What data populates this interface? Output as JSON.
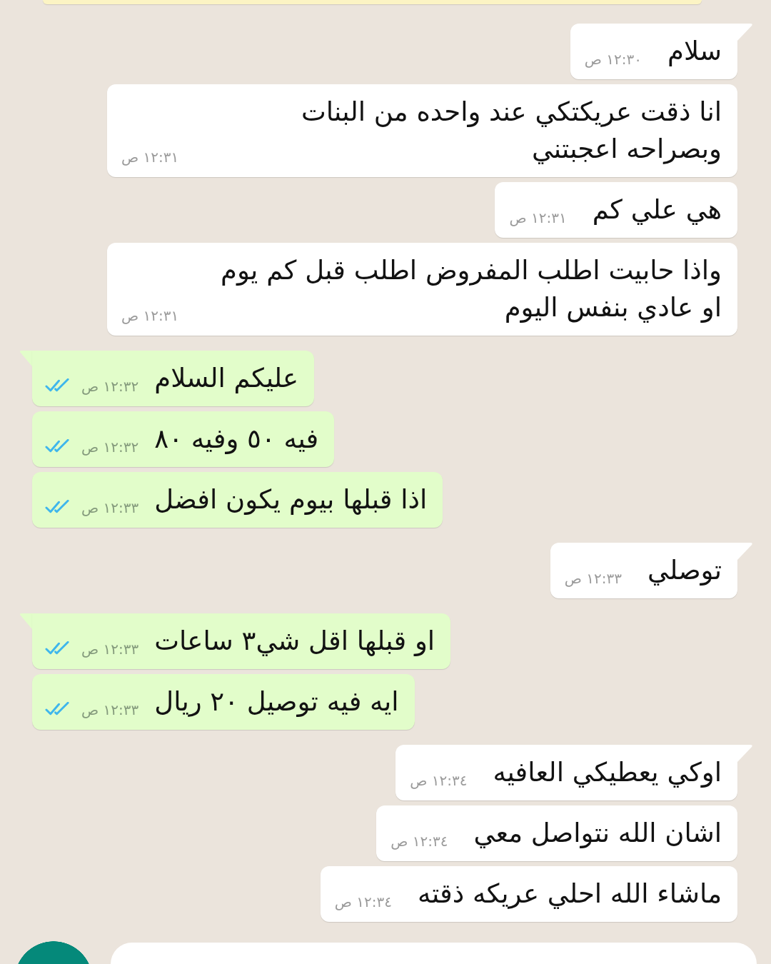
{
  "chat": {
    "messages": [
      {
        "kind": "incoming",
        "tail": true,
        "text": "سلام",
        "time": "١٢:٣٠ ص"
      },
      {
        "kind": "incoming",
        "tail": false,
        "text": "انا ذقت عريكتكي عند واحده من البنات\nوبصراحه اعجبتني",
        "time": "١٢:٣١ ص"
      },
      {
        "kind": "incoming",
        "tail": false,
        "text": "هي علي كم",
        "time": "١٢:٣١ ص"
      },
      {
        "kind": "incoming",
        "tail": false,
        "text": "واذا حابيت اطلب المفروض اطلب قبل كم يوم\nاو عادي بنفس اليوم",
        "time": "١٢:٣١ ص"
      },
      {
        "kind": "outgoing",
        "tail": true,
        "text": "عليكم السلام",
        "time": "١٢:٣٢ ص",
        "read": true
      },
      {
        "kind": "outgoing",
        "tail": false,
        "text": "فيه ٥٠ وفيه ٨٠",
        "time": "١٢:٣٢ ص",
        "read": true
      },
      {
        "kind": "outgoing",
        "tail": false,
        "text": "اذا قبلها بيوم يكون افضل",
        "time": "١٢:٣٣ ص",
        "read": true
      },
      {
        "kind": "incoming",
        "tail": true,
        "text": "توصلي",
        "time": "١٢:٣٣ ص"
      },
      {
        "kind": "outgoing",
        "tail": true,
        "text": "او قبلها اقل شي٣ ساعات",
        "time": "١٢:٣٣ ص",
        "read": true
      },
      {
        "kind": "outgoing",
        "tail": false,
        "text": "ايه فيه توصيل ٢٠ ريال",
        "time": "١٢:٣٣ ص",
        "read": true
      },
      {
        "kind": "incoming",
        "tail": true,
        "text": "اوكي يعطيكي العافيه",
        "time": "١٢:٣٤ ص"
      },
      {
        "kind": "incoming",
        "tail": false,
        "text": "اشان الله نتواصل معي",
        "time": "١٢:٣٤ ص"
      },
      {
        "kind": "incoming",
        "tail": false,
        "text": "ماشاء الله احلي عريكه ذقته",
        "time": "١٢:٣٤ ص"
      }
    ]
  }
}
